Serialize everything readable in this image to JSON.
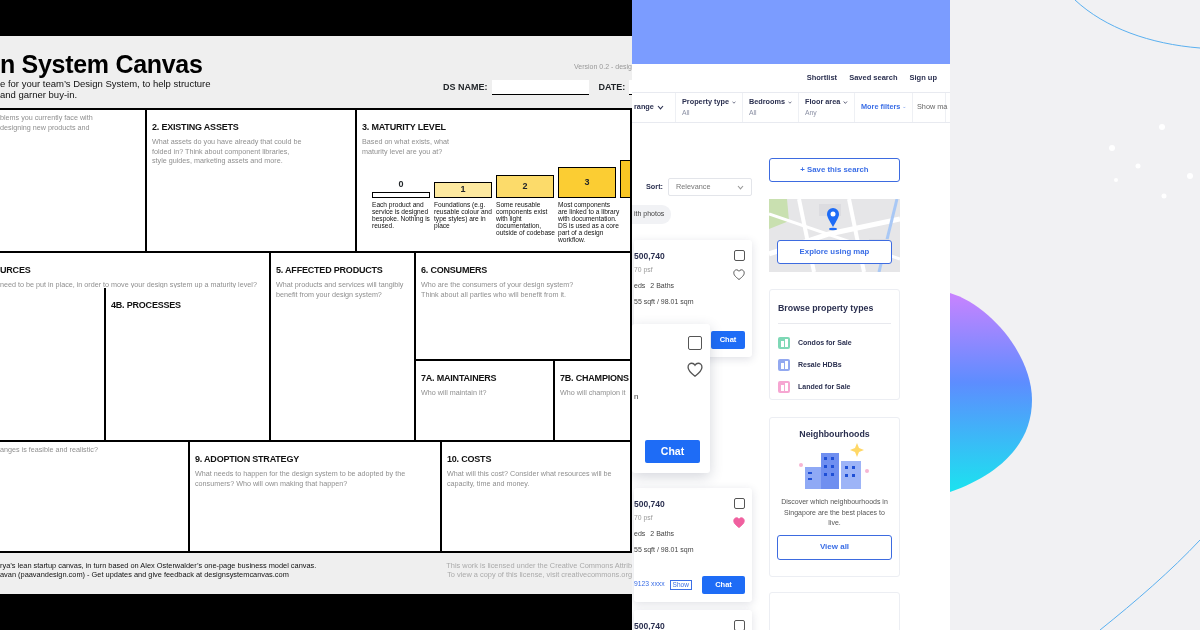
{
  "design_canvas": {
    "title": "n System Canvas",
    "subtitle_lines": [
      "e for your team’s Design System, to help structure",
      "and garner buy-in."
    ],
    "version": "Version 0.2 - desig",
    "fields": [
      {
        "label": "DS NAME:"
      },
      {
        "label": "DATE:"
      }
    ],
    "sections": [
      {
        "prompt_lines": [
          "blems you currently face with",
          "designing new products and"
        ]
      },
      {
        "heading": "2. EXISTING ASSETS",
        "prompt_lines": [
          "What assets do you have already that could be",
          "folded in? Think about component libraries,",
          "style guides, marketing assets and more."
        ]
      },
      {
        "heading": "3. MATURITY LEVEL",
        "prompt_lines": [
          "Based on what exists, what",
          "maturity level are you at?"
        ],
        "maturity_steps": [
          {
            "number": "0",
            "level": 0.16,
            "color": "#ffffff",
            "description": "Each product and service is designed bespoke. Nothing is reused."
          },
          {
            "number": "1",
            "level": 0.43,
            "color": "#fde9a0",
            "description": "Foundations (e.g. reusable colour and type styles) are in place"
          },
          {
            "number": "2",
            "level": 0.6,
            "color": "#fcdb6a",
            "description": "Some reusable components exist with light documentation, outside of codebase"
          },
          {
            "number": "3",
            "level": 0.81,
            "color": "#fbcd33",
            "description": "Most components are linked to a library with documentation. DS is used as a core part of a design workflow."
          },
          {
            "level": 1,
            "color": "#f9c623"
          }
        ]
      },
      {
        "heading": "URCES",
        "prompt_lines": [
          "need to be put in place, in order to move your design system up a maturity level?"
        ]
      },
      {
        "heading": "4B. PROCESSES"
      },
      {
        "heading": "5. AFFECTED PRODUCTS",
        "prompt_lines": [
          "What products and services will tangibly",
          "benefit from your design system?"
        ]
      },
      {
        "heading": "6. CONSUMERS",
        "prompt_lines": [
          "Who are the consumers of your design system?",
          "Think about all parties who will benefit from it."
        ]
      },
      {
        "heading": "7A. MAINTAINERS",
        "prompt_lines": [
          "Who will maintain it?"
        ]
      },
      {
        "heading": "7B. CHAMPIONS",
        "prompt_lines": [
          "Who will champion it"
        ]
      },
      {
        "prompt_lines": [
          "anges is feasible and realistic?"
        ]
      },
      {
        "heading": "9. ADOPTION STRATEGY",
        "prompt_lines": [
          "What needs to happen for the design system to be adopted by the",
          "consumers? Who will own making that happen?"
        ]
      },
      {
        "heading": "10. COSTS",
        "prompt_lines": [
          "What will this cost? Consider what resources will be",
          "capacity, time and money."
        ]
      }
    ],
    "footer_left": [
      "rya’s lean startup canvas, in turn based on Alex Osterwalder’s one-page business model canvas.",
      "avan (paavandesign.com) - Get updates and give feedback at designsystemcanvas.com"
    ],
    "footer_right": [
      "This work is licensed under the Creative Commons Attrib",
      "To view a copy of this license, visit creativecommons.org"
    ]
  },
  "property_site": {
    "nav_links": [
      "Shortlist",
      "Saved search",
      "Sign up"
    ],
    "filters": [
      {
        "label": "range",
        "kind": "dropdown"
      },
      {
        "label": "Property type",
        "value": "All",
        "kind": "dropdown"
      },
      {
        "label": "Bedrooms",
        "value": "All",
        "kind": "dropdown"
      },
      {
        "label": "Floor area",
        "value": "Any",
        "kind": "dropdown"
      },
      {
        "label": "More filters",
        "kind": "link"
      },
      {
        "label": "Show ma",
        "kind": "plain"
      }
    ],
    "sort": {
      "label": "Sort:",
      "value": "Relevance"
    },
    "chip": "ith photos",
    "listings": [
      {
        "price": "500,740",
        "psf": "70 psf",
        "rooms": [
          "eds",
          "2 Baths"
        ],
        "area": "55 sqft / 98.01 sqm",
        "checked": false,
        "favorite": false,
        "chat": "Chat"
      },
      {
        "price": "500,740",
        "psf": "70 psf",
        "rooms": [
          "eds",
          "2 Baths"
        ],
        "area": "55 sqft / 98.01 sqm",
        "phone": "9123 xxxx",
        "show": "Show",
        "checked": false,
        "favorite": true,
        "chat": "Chat"
      },
      {
        "price": "500,740",
        "checked": false
      }
    ],
    "popup_card": {
      "checked": false,
      "favorite": false,
      "text": "n",
      "chat": "Chat"
    },
    "save_search": "+ Save this search",
    "map_button": "Explore using map",
    "browse": {
      "title": "Browse property types",
      "items": [
        {
          "label": "Condos for Sale",
          "color": "#7fd8b6"
        },
        {
          "label": "Resale HDBs",
          "color": "#93a9f0"
        },
        {
          "label": "Landed for Sale",
          "color": "#f6a6d2"
        }
      ]
    },
    "neighbourhoods": {
      "title": "Neighbourhoods",
      "text": "Discover which neighbourhoods in Singapore are the best places to live.",
      "button": "View all"
    }
  }
}
